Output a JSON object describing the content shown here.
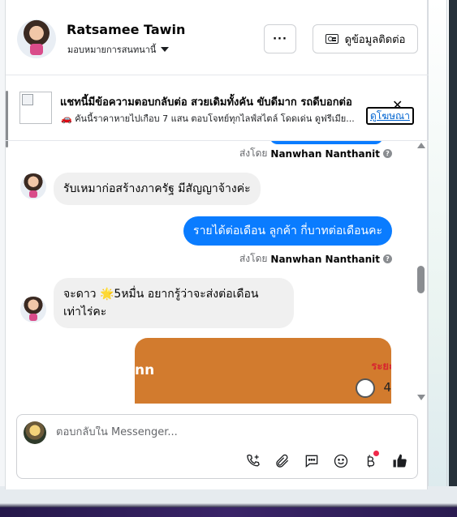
{
  "header": {
    "name": "Ratsamee Tawin",
    "subtitle": "มอบหมายการสนทนานี้",
    "more_label": "···",
    "contact_label": "ดูข้อมูลติดต่อ"
  },
  "ad": {
    "title": "แชทนี้มีข้อความตอบกลับต่อ สวยเดิมทั้งคัน ขับดีมาก รถดีบอกต่อ",
    "subtitle": "🚗 คันนี้ราคาหายไปเกือบ 7 แสน ตอบโจทย์ทุกไลฟ์สไตล์ โดดเด่น ดูฟรีเมีย...",
    "link_label": "ดูโฆษณา",
    "close_label": "✕"
  },
  "messages": {
    "sent_by_prefix": "ส่งโดย",
    "sent_by_name": "Nanwhan Nanthanit",
    "incoming_1": "รับเหมาก่อสร้างภาครัฐ มีสัญญาจ้างค่ะ",
    "outgoing_1": "รายได้ต่อเดือน ลูกค้า กี่บาทต่อเดือนคะ",
    "incoming_2_line1": "จะดาว 🌟5หมื่น อยากรู้ว่าจะส่งต่อเดือน",
    "incoming_2_line2": "เท่าไร่คะ",
    "image_text_left": "nn",
    "image_text_right": "ระยะ",
    "image_text_num": "4"
  },
  "composer": {
    "placeholder": "ตอบกลับใน Messenger..."
  },
  "icons": {
    "phone": "phone-plus-icon",
    "attach": "paperclip-icon",
    "saved_replies": "chat-bubble-icon",
    "emoji": "emoji-icon",
    "payment": "baht-icon",
    "like": "thumbs-up-icon"
  },
  "colors": {
    "accent": "#0a7cff",
    "incoming_bubble": "#f0f0f0",
    "link": "#0064d1"
  }
}
